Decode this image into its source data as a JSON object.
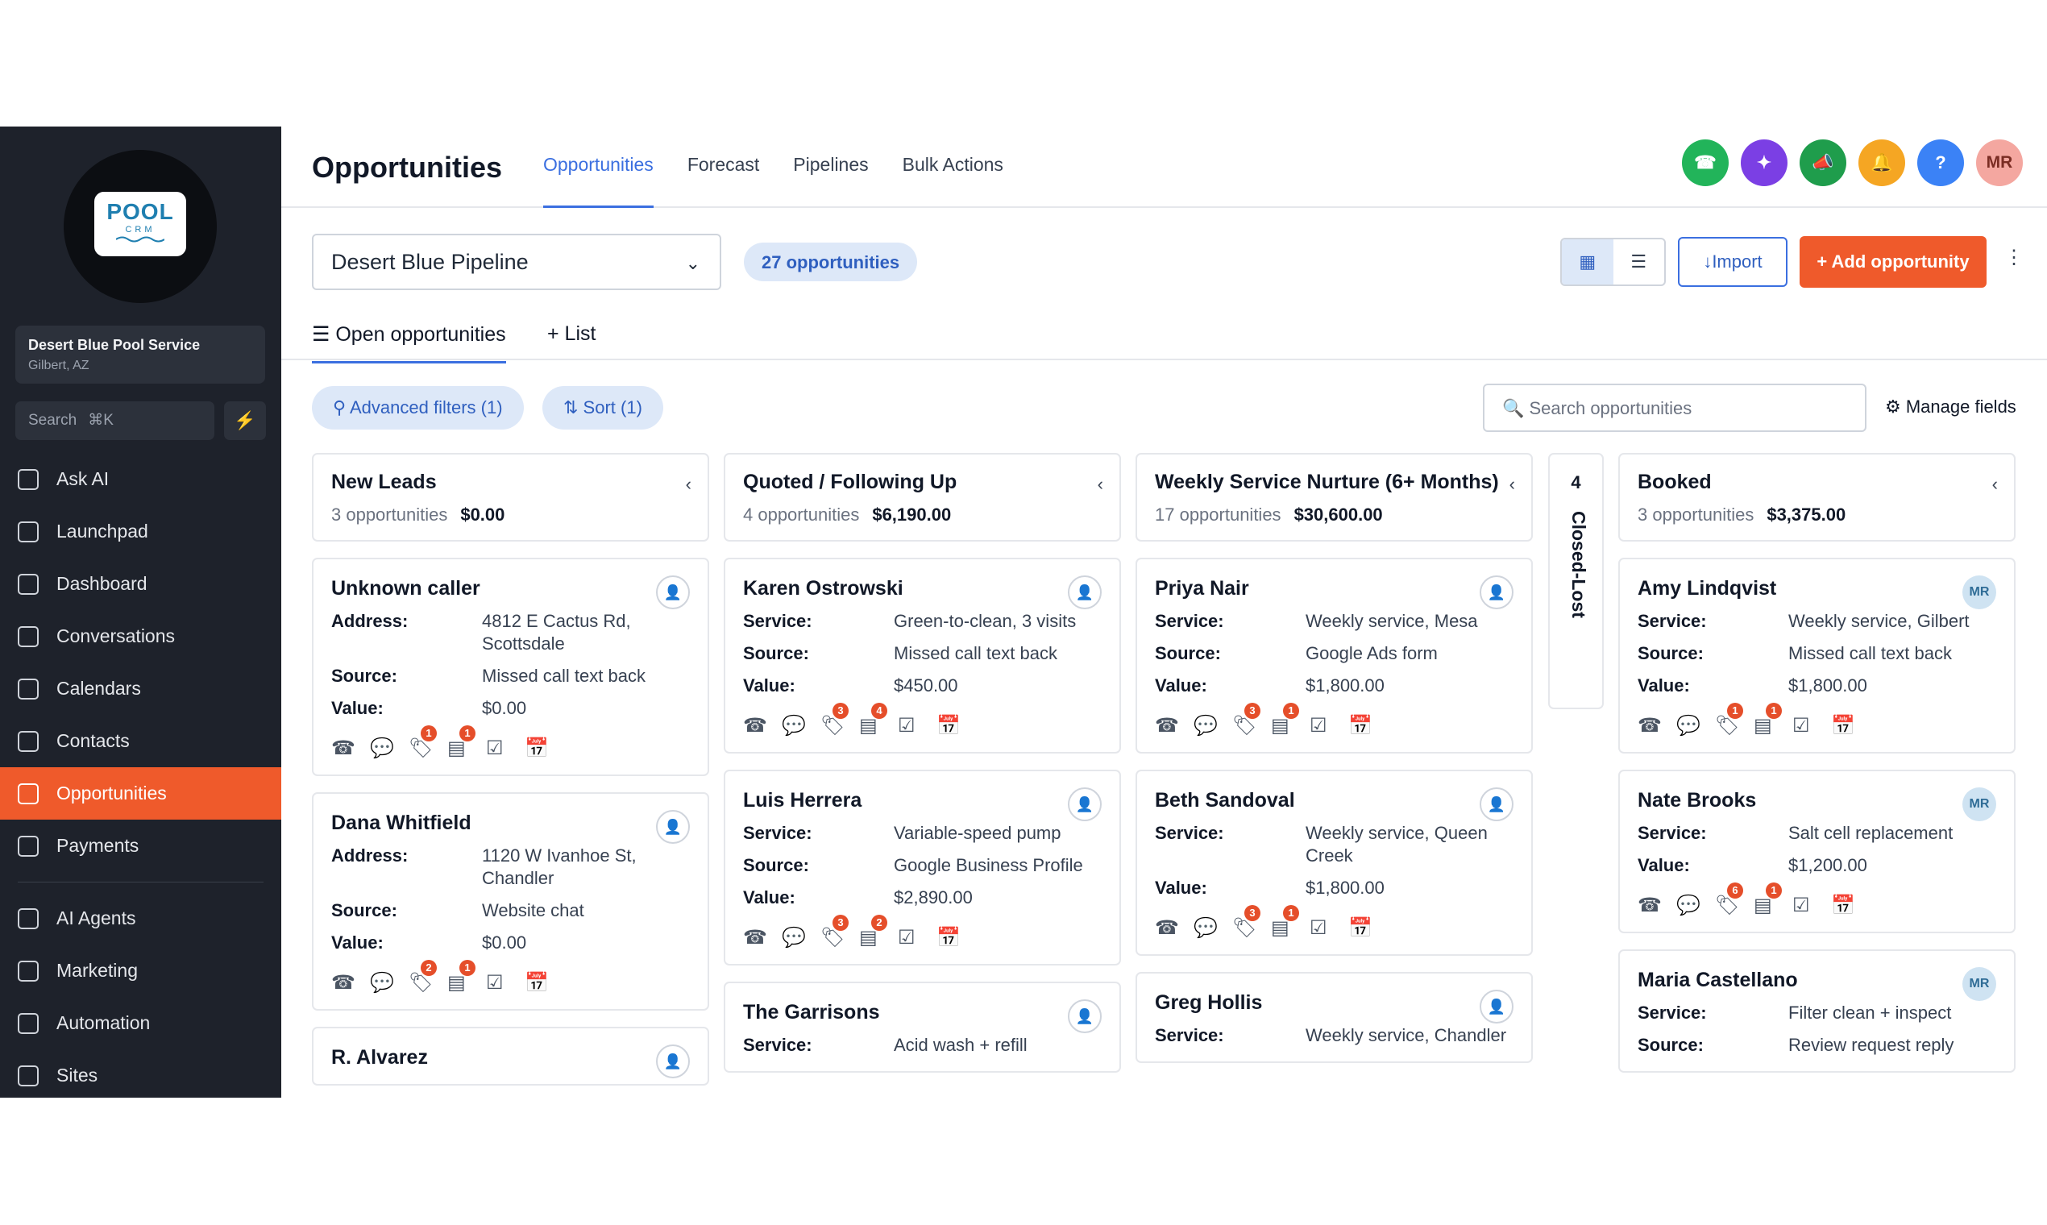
{
  "sidebar": {
    "logo_top": "POOL",
    "logo_bottom": "CRM",
    "business_name": "Desert Blue Pool Service",
    "business_location": "Gilbert, AZ",
    "search_label": "Search",
    "search_shortcut": "⌘K",
    "bolt_icon": "⚡",
    "nav_main": [
      "Ask AI",
      "Launchpad",
      "Dashboard",
      "Conversations",
      "Calendars",
      "Contacts",
      "Opportunities",
      "Payments"
    ],
    "nav_secondary": [
      "AI Agents",
      "Marketing",
      "Automation",
      "Sites"
    ],
    "active_item": "Opportunities"
  },
  "header": {
    "title": "Opportunities",
    "tabs": [
      "Opportunities",
      "Forecast",
      "Pipelines",
      "Bulk Actions"
    ],
    "active_tab": "Opportunities",
    "icons": [
      {
        "name": "phone-icon",
        "glyph": "☎",
        "color": "#22b45a"
      },
      {
        "name": "sparkle-icon",
        "glyph": "✦",
        "color": "#7b3fe4"
      },
      {
        "name": "megaphone-icon",
        "glyph": "📣",
        "color": "#1f9d4c"
      },
      {
        "name": "bell-icon",
        "glyph": "🔔",
        "color": "#f5a623"
      },
      {
        "name": "help-icon",
        "glyph": "?",
        "color": "#3b82f6"
      }
    ],
    "user_initials": "MR"
  },
  "toolbar": {
    "pipeline": "Desert Blue Pipeline",
    "pipeline_chevron": "⌄",
    "count_label": "27 opportunities",
    "grid_icon": "▦",
    "list_icon": "☰",
    "import_label": "↓Import",
    "add_label": "+ Add opportunity",
    "more_icon": "⋮"
  },
  "subtabs": {
    "open_label": "☰ Open opportunities",
    "list_label": "+ List"
  },
  "filters": {
    "advanced_label": "⚲ Advanced filters (1)",
    "sort_label": "⇅ Sort (1)",
    "search_placeholder": "🔍 Search opportunities",
    "manage_label": "⚙ Manage fields"
  },
  "action_icons": [
    "☎",
    "💬",
    "🏷",
    "▤",
    "☑",
    "📅"
  ],
  "columns": [
    {
      "title": "New Leads",
      "count": "3 opportunities",
      "total": "$0.00",
      "cards": [
        {
          "name": "Unknown caller",
          "avatar": "👤",
          "fields": [
            {
              "k": "Address:",
              "v": "4812 E Cactus Rd, Scottsdale"
            },
            {
              "k": "Source:",
              "v": "Missed call text back"
            },
            {
              "k": "Value:",
              "v": "$0.00"
            }
          ],
          "badges": [
            "",
            "",
            "1",
            "1",
            "",
            ""
          ]
        },
        {
          "name": "Dana Whitfield",
          "avatar": "👤",
          "fields": [
            {
              "k": "Address:",
              "v": "1120 W Ivanhoe St, Chandler"
            },
            {
              "k": "Source:",
              "v": "Website chat"
            },
            {
              "k": "Value:",
              "v": "$0.00"
            }
          ],
          "badges": [
            "",
            "",
            "2",
            "1",
            "",
            ""
          ]
        },
        {
          "name": "R. Alvarez",
          "avatar": "👤",
          "fields": [],
          "badges": []
        }
      ]
    },
    {
      "title": "Quoted / Following Up",
      "count": "4 opportunities",
      "total": "$6,190.00",
      "cards": [
        {
          "name": "Karen Ostrowski",
          "avatar": "👤",
          "fields": [
            {
              "k": "Service:",
              "v": "Green-to-clean, 3 visits"
            },
            {
              "k": "Source:",
              "v": "Missed call text back"
            },
            {
              "k": "Value:",
              "v": "$450.00"
            }
          ],
          "badges": [
            "",
            "",
            "3",
            "4",
            "",
            ""
          ]
        },
        {
          "name": "Luis Herrera",
          "avatar": "👤",
          "fields": [
            {
              "k": "Service:",
              "v": "Variable-speed pump"
            },
            {
              "k": "Source:",
              "v": "Google Business Profile"
            },
            {
              "k": "Value:",
              "v": "$2,890.00"
            }
          ],
          "badges": [
            "",
            "",
            "3",
            "2",
            "",
            ""
          ]
        },
        {
          "name": "The Garrisons",
          "avatar": "👤",
          "fields": [
            {
              "k": "Service:",
              "v": "Acid wash + refill"
            }
          ],
          "badges": []
        }
      ]
    },
    {
      "title": "Weekly Service Nurture (6+ Months)",
      "count": "17 opportunities",
      "total": "$30,600.00",
      "cards": [
        {
          "name": "Priya Nair",
          "avatar": "👤",
          "fields": [
            {
              "k": "Service:",
              "v": "Weekly service, Mesa"
            },
            {
              "k": "Source:",
              "v": "Google Ads form"
            },
            {
              "k": "Value:",
              "v": "$1,800.00"
            }
          ],
          "badges": [
            "",
            "",
            "3",
            "1",
            "",
            ""
          ]
        },
        {
          "name": "Beth Sandoval",
          "avatar": "👤",
          "fields": [
            {
              "k": "Service:",
              "v": "Weekly service, Queen Creek"
            },
            {
              "k": "Value:",
              "v": "$1,800.00"
            }
          ],
          "badges": [
            "",
            "",
            "3",
            "1",
            "",
            ""
          ]
        },
        {
          "name": "Greg Hollis",
          "avatar": "👤",
          "fields": [
            {
              "k": "Service:",
              "v": "Weekly service, Chandler"
            }
          ],
          "badges": []
        }
      ]
    },
    {
      "title": "Booked",
      "count": "3 opportunities",
      "total": "$3,375.00",
      "cards": [
        {
          "name": "Amy Lindqvist",
          "avatar": "MR",
          "fields": [
            {
              "k": "Service:",
              "v": "Weekly service, Gilbert"
            },
            {
              "k": "Source:",
              "v": "Missed call text back"
            },
            {
              "k": "Value:",
              "v": "$1,800.00"
            }
          ],
          "badges": [
            "",
            "",
            "1",
            "1",
            "",
            ""
          ]
        },
        {
          "name": "Nate Brooks",
          "avatar": "MR",
          "fields": [
            {
              "k": "Service:",
              "v": "Salt cell replacement"
            },
            {
              "k": "Value:",
              "v": "$1,200.00"
            }
          ],
          "badges": [
            "",
            "",
            "6",
            "1",
            "",
            ""
          ]
        },
        {
          "name": "Maria Castellano",
          "avatar": "MR",
          "fields": [
            {
              "k": "Service:",
              "v": "Filter clean + inspect"
            },
            {
              "k": "Source:",
              "v": "Review request reply"
            }
          ],
          "badges": []
        }
      ]
    }
  ],
  "closed_lost": {
    "count": "4",
    "label": "Closed-Lost"
  },
  "collapse_icon": "‹"
}
